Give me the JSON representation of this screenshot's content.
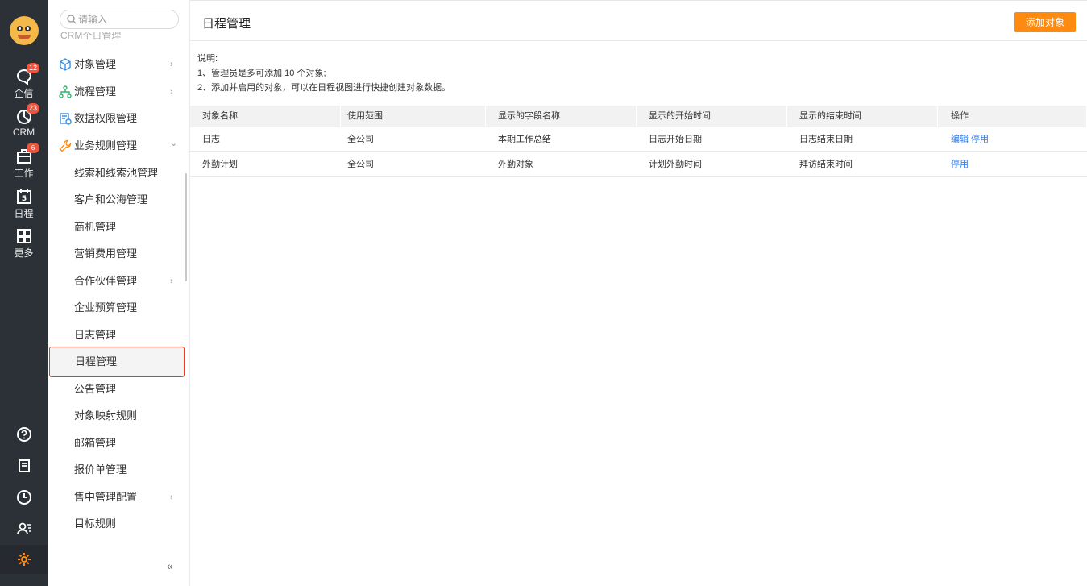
{
  "rail": {
    "items": [
      {
        "label": "企信",
        "badge": "12",
        "icon": "chat-bubble-icon"
      },
      {
        "label": "CRM",
        "badge": "23",
        "icon": "pie-chart-icon"
      },
      {
        "label": "工作",
        "badge": "6",
        "icon": "briefcase-icon"
      },
      {
        "label": "日程",
        "badge": "",
        "icon": "calendar-icon",
        "day": "5"
      },
      {
        "label": "更多",
        "badge": "",
        "icon": "grid-icon"
      }
    ],
    "bottom": [
      "help-icon",
      "notebook-icon",
      "clock-icon",
      "contacts-icon",
      "settings-gear-icon"
    ]
  },
  "sidebar": {
    "search_placeholder": "请输入",
    "cutoff_text": "CRM个日管理",
    "items": [
      {
        "label": "对象管理",
        "icon": "cube-icon",
        "chevron": "›"
      },
      {
        "label": "流程管理",
        "icon": "flow-icon",
        "chevron": "›"
      },
      {
        "label": "数据权限管理",
        "icon": "data-permission-icon",
        "chevron": ""
      },
      {
        "label": "业务规则管理",
        "icon": "wrench-icon",
        "chevron": "⌄"
      },
      {
        "label": "线索和线索池管理",
        "chevron": ""
      },
      {
        "label": "客户和公海管理",
        "chevron": ""
      },
      {
        "label": "商机管理",
        "chevron": ""
      },
      {
        "label": "营销费用管理",
        "chevron": ""
      },
      {
        "label": "合作伙伴管理",
        "chevron": "›"
      },
      {
        "label": "企业预算管理",
        "chevron": ""
      },
      {
        "label": "日志管理",
        "chevron": ""
      },
      {
        "label": "日程管理",
        "chevron": "",
        "selected": true
      },
      {
        "label": "公告管理",
        "chevron": ""
      },
      {
        "label": "对象映射规则",
        "chevron": ""
      },
      {
        "label": "邮箱管理",
        "chevron": ""
      },
      {
        "label": "报价单管理",
        "chevron": ""
      },
      {
        "label": "售中管理配置",
        "chevron": "›"
      },
      {
        "label": "目标规则",
        "chevron": ""
      }
    ],
    "collapse_label": "«"
  },
  "main": {
    "title": "日程管理",
    "add_button": "添加对象",
    "desc_title": "说明:",
    "desc_line1": "1、管理员是多可添加 10 个对象;",
    "desc_line2": "2、添加并启用的对象，可以在日程视图进行快捷创建对象数据。",
    "table": {
      "headers": [
        "对象名称",
        "使用范围",
        "显示的字段名称",
        "显示的开始时间",
        "显示的结束时间",
        "操作"
      ],
      "rows": [
        {
          "name": "日志",
          "scope": "全公司",
          "field": "本期工作总结",
          "start": "日志开始日期",
          "end": "日志结束日期",
          "actions": [
            "编辑",
            "停用"
          ]
        },
        {
          "name": "外勤计划",
          "scope": "全公司",
          "field": "外勤对象",
          "start": "计划外勤时间",
          "end": "拜访结束时间",
          "actions": [
            "停用"
          ]
        }
      ]
    }
  },
  "colors": {
    "rail_bg": "#2c3037",
    "accent_orange": "#ff8a10",
    "link_blue": "#2f7ae5",
    "selected_border": "#e83a26",
    "badge_red": "#f0533e"
  }
}
